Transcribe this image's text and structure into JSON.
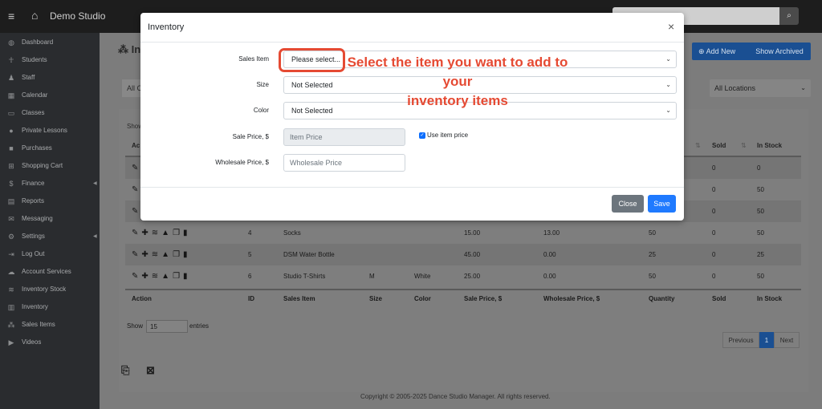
{
  "topbar": {
    "brand": "Demo Studio"
  },
  "sidebar": {
    "items": [
      {
        "label": "Dashboard",
        "icon": "dashboard-icon",
        "glyph": "◍"
      },
      {
        "label": "Students",
        "icon": "student-icon",
        "glyph": "☥"
      },
      {
        "label": "Staff",
        "icon": "staff-icon",
        "glyph": "♟"
      },
      {
        "label": "Calendar",
        "icon": "calendar-icon",
        "glyph": "▦"
      },
      {
        "label": "Classes",
        "icon": "classes-icon",
        "glyph": "▭"
      },
      {
        "label": "Private Lessons",
        "icon": "private-lessons-icon",
        "glyph": "●"
      },
      {
        "label": "Purchases",
        "icon": "purchases-icon",
        "glyph": "■"
      },
      {
        "label": "Shopping Cart",
        "icon": "cart-icon",
        "glyph": "⊞"
      },
      {
        "label": "Finance",
        "icon": "dollar-icon",
        "glyph": "$"
      },
      {
        "label": "Reports",
        "icon": "reports-icon",
        "glyph": "▤"
      },
      {
        "label": "Messaging",
        "icon": "envelope-icon",
        "glyph": "✉"
      },
      {
        "label": "Settings",
        "icon": "gear-icon",
        "glyph": "⚙"
      },
      {
        "label": "Log Out",
        "icon": "logout-icon",
        "glyph": "⇥"
      },
      {
        "label": "Account Services",
        "icon": "cloud-icon",
        "glyph": "☁"
      },
      {
        "label": "Inventory Stock",
        "icon": "layers-icon",
        "glyph": "≋"
      },
      {
        "label": "Inventory",
        "icon": "inventory-icon",
        "glyph": "▥"
      },
      {
        "label": "Sales Items",
        "icon": "sales-items-icon",
        "glyph": "⁂"
      },
      {
        "label": "Videos",
        "icon": "video-icon",
        "glyph": "▶"
      }
    ]
  },
  "page": {
    "title": "In",
    "add_new": "Add New",
    "show_archived": "Show Archived",
    "filter_left": "All C",
    "filter_location": "All Locations"
  },
  "table": {
    "show_top": "Show",
    "action_top": "Ac",
    "right_headers": {
      "sold": "Sold",
      "in_stock": "In Stock"
    },
    "hidden_rows": [
      {
        "sold": "0",
        "in_stock": "0"
      },
      {
        "sold": "0",
        "in_stock": "50"
      },
      {
        "sold": "0",
        "in_stock": "50"
      }
    ],
    "rows": [
      {
        "id": "4",
        "item": "Socks",
        "size": "",
        "color": "",
        "sale": "15.00",
        "wholesale": "13.00",
        "qty": "50",
        "sold": "0",
        "stock": "50"
      },
      {
        "id": "5",
        "item": "DSM Water Bottle",
        "size": "",
        "color": "",
        "sale": "45.00",
        "wholesale": "0.00",
        "qty": "25",
        "sold": "0",
        "stock": "25"
      },
      {
        "id": "6",
        "item": "Studio T-Shirts",
        "size": "M",
        "color": "White",
        "sale": "25.00",
        "wholesale": "0.00",
        "qty": "50",
        "sold": "0",
        "stock": "50"
      }
    ],
    "footer_headers": {
      "action": "Action",
      "id": "ID",
      "item": "Sales Item",
      "size": "Size",
      "color": "Color",
      "sale": "Sale Price, $",
      "wholesale": "Wholesale Price, $",
      "qty": "Quantity",
      "sold": "Sold",
      "stock": "In Stock"
    },
    "show_label": "Show",
    "entries_value": "15",
    "entries_label": "entries",
    "pager": {
      "previous": "Previous",
      "page": "1",
      "next": "Next"
    }
  },
  "footer": {
    "copyright": "Copyright © 2005-2025 Dance Studio Manager. All rights reserved."
  },
  "modal": {
    "title": "Inventory",
    "sales_item_label": "Sales Item",
    "sales_item_value": "Please select...",
    "size_label": "Size",
    "size_value": "Not Selected",
    "color_label": "Color",
    "color_value": "Not Selected",
    "sale_price_label": "Sale Price, $",
    "sale_price_placeholder": "Item Price",
    "use_item_price_label": "Use item price",
    "wholesale_label": "Wholesale Price, $",
    "wholesale_placeholder": "Wholesale Price",
    "close_label": "Close",
    "save_label": "Save"
  },
  "annotation": {
    "line1": "Select the item you want to add to your",
    "line2": "inventory items"
  },
  "colors": {
    "accent": "#1f7aff",
    "annotation": "#e54a33",
    "sidebar": "#2a2c2f"
  }
}
